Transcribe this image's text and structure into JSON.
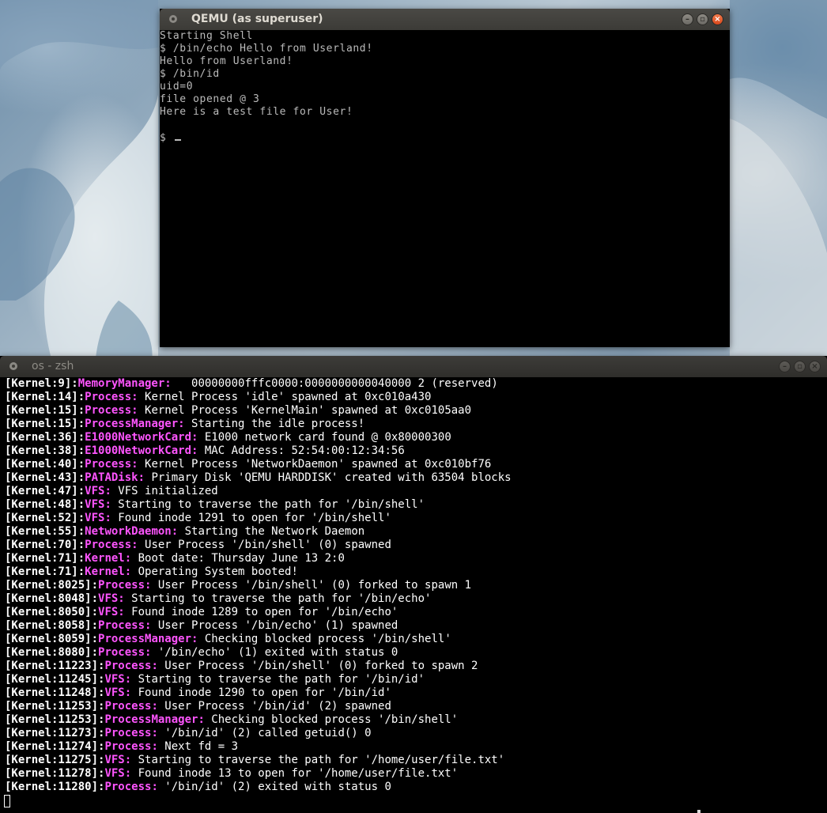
{
  "qemu": {
    "title": "QEMU (as superuser)",
    "lines": [
      "Starting Shell",
      "$ /bin/echo Hello from Userland!",
      "Hello from Userland!",
      "$ /bin/id",
      "uid=0",
      "file opened @ 3",
      "Here is a test file for User!",
      "",
      "$"
    ]
  },
  "zsh": {
    "title": "os - zsh",
    "log": [
      {
        "prefix": "[Kernel:9]:",
        "module": "MemoryManager:",
        "message": "   00000000fffc0000:0000000000040000 2 (reserved)"
      },
      {
        "prefix": "[Kernel:14]:",
        "module": "Process:",
        "message": " Kernel Process 'idle' spawned at 0xc010a430"
      },
      {
        "prefix": "[Kernel:15]:",
        "module": "Process:",
        "message": " Kernel Process 'KernelMain' spawned at 0xc0105aa0"
      },
      {
        "prefix": "[Kernel:15]:",
        "module": "ProcessManager:",
        "message": " Starting the idle process!"
      },
      {
        "prefix": "[Kernel:36]:",
        "module": "E1000NetworkCard:",
        "message": " E1000 network card found @ 0x80000300"
      },
      {
        "prefix": "[Kernel:38]:",
        "module": "E1000NetworkCard:",
        "message": " MAC Address: 52:54:00:12:34:56"
      },
      {
        "prefix": "[Kernel:40]:",
        "module": "Process:",
        "message": " Kernel Process 'NetworkDaemon' spawned at 0xc010bf76"
      },
      {
        "prefix": "[Kernel:43]:",
        "module": "PATADisk:",
        "message": " Primary Disk 'QEMU HARDDISK' created with 63504 blocks"
      },
      {
        "prefix": "[Kernel:47]:",
        "module": "VFS:",
        "message": " VFS initialized"
      },
      {
        "prefix": "[Kernel:48]:",
        "module": "VFS:",
        "message": " Starting to traverse the path for '/bin/shell'"
      },
      {
        "prefix": "[Kernel:52]:",
        "module": "VFS:",
        "message": " Found inode 1291 to open for '/bin/shell'"
      },
      {
        "prefix": "[Kernel:55]:",
        "module": "NetworkDaemon:",
        "message": " Starting the Network Daemon"
      },
      {
        "prefix": "[Kernel:70]:",
        "module": "Process:",
        "message": " User Process '/bin/shell' (0) spawned"
      },
      {
        "prefix": "[Kernel:71]:",
        "module": "Kernel:",
        "message": " Boot date: Thursday June 13 2:0"
      },
      {
        "prefix": "[Kernel:71]:",
        "module": "Kernel:",
        "message": " Operating System booted!"
      },
      {
        "prefix": "[Kernel:8025]:",
        "module": "Process:",
        "message": " User Process '/bin/shell' (0) forked to spawn 1"
      },
      {
        "prefix": "[Kernel:8048]:",
        "module": "VFS:",
        "message": " Starting to traverse the path for '/bin/echo'"
      },
      {
        "prefix": "[Kernel:8050]:",
        "module": "VFS:",
        "message": " Found inode 1289 to open for '/bin/echo'"
      },
      {
        "prefix": "[Kernel:8058]:",
        "module": "Process:",
        "message": " User Process '/bin/echo' (1) spawned"
      },
      {
        "prefix": "[Kernel:8059]:",
        "module": "ProcessManager:",
        "message": " Checking blocked process '/bin/shell'"
      },
      {
        "prefix": "[Kernel:8080]:",
        "module": "Process:",
        "message": " '/bin/echo' (1) exited with status 0"
      },
      {
        "prefix": "[Kernel:11223]:",
        "module": "Process:",
        "message": " User Process '/bin/shell' (0) forked to spawn 2"
      },
      {
        "prefix": "[Kernel:11245]:",
        "module": "VFS:",
        "message": " Starting to traverse the path for '/bin/id'"
      },
      {
        "prefix": "[Kernel:11248]:",
        "module": "VFS:",
        "message": " Found inode 1290 to open for '/bin/id'"
      },
      {
        "prefix": "[Kernel:11253]:",
        "module": "Process:",
        "message": " User Process '/bin/id' (2) spawned"
      },
      {
        "prefix": "[Kernel:11253]:",
        "module": "ProcessManager:",
        "message": " Checking blocked process '/bin/shell'"
      },
      {
        "prefix": "[Kernel:11273]:",
        "module": "Process:",
        "message": " '/bin/id' (2) called getuid() 0"
      },
      {
        "prefix": "[Kernel:11274]:",
        "module": "Process:",
        "message": " Next fd = 3"
      },
      {
        "prefix": "[Kernel:11275]:",
        "module": "VFS:",
        "message": " Starting to traverse the path for '/home/user/file.txt'"
      },
      {
        "prefix": "[Kernel:11278]:",
        "module": "VFS:",
        "message": " Found inode 13 to open for '/home/user/file.txt'"
      },
      {
        "prefix": "[Kernel:11280]:",
        "module": "Process:",
        "message": " '/bin/id' (2) exited with status 0"
      }
    ]
  },
  "colors": {
    "module_magenta": "#ff55ff",
    "titlebar_active": "#3c3b37",
    "close_button": "#e25a2a",
    "qemu_text": "#bbbbbb"
  }
}
